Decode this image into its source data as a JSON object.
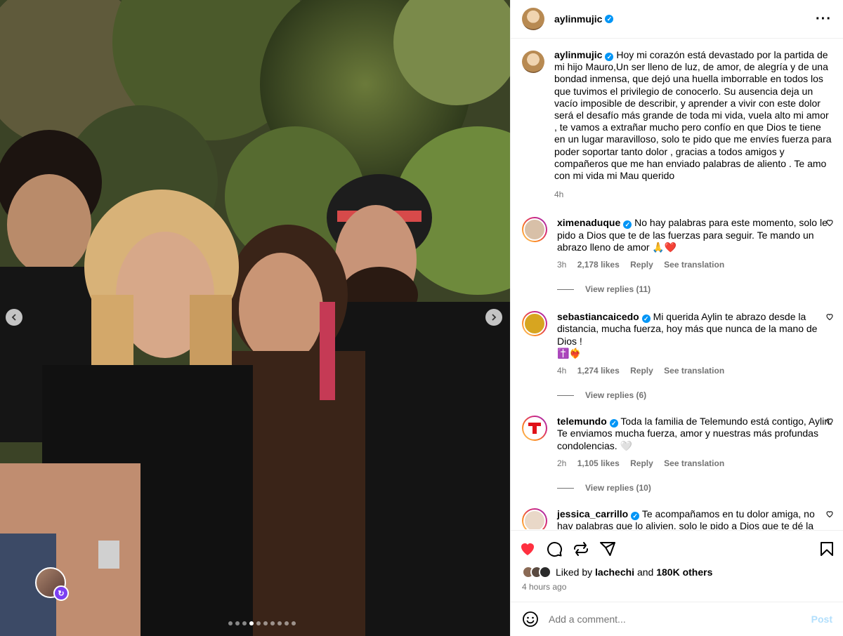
{
  "post": {
    "author": "aylinmujic",
    "more_icon": "more-horizontal-icon",
    "caption": "Hoy mi corazón está devastado por la partida de mi hijo Mauro,Un ser lleno de luz, de amor, de alegría y de una bondad inmensa, que dejó una huella imborrable en todos los que tuvimos el privilegio de conocerlo. Su ausencia deja un vacío imposible de describir, y aprender a vivir con este dolor será el desafío más grande de toda mi vida, vuela alto mi amor , te vamos a extrañar mucho pero confío en que Dios te tiene en un lugar maravilloso, solo te pido que me envíes fuerza para poder soportar tanto dolor , gracias a todos amigos y compañeros que me han enviado palabras de aliento . Te amo con mi vida mi Mau querido",
    "caption_time": "4h"
  },
  "comments": [
    {
      "user": "ximenaduque",
      "text": "No hay palabras para este momento, solo le pido a Dios que te de las fuerzas para seguir. Te mando un abrazo lleno de amor 🙏❤️",
      "time": "3h",
      "likes": "2,178 likes",
      "reply": "Reply",
      "translate": "See translation",
      "replies": "View replies (11)"
    },
    {
      "user": "sebastiancaicedo",
      "text": "Mi querida Aylin te abrazo desde la distancia, mucha fuerza, hoy más que nunca de la mano de Dios !",
      "text2": "✝️❤️‍🔥",
      "time": "4h",
      "likes": "1,274 likes",
      "reply": "Reply",
      "translate": "See translation",
      "replies": "View replies (6)"
    },
    {
      "user": "telemundo",
      "text": "Toda la familia de Telemundo está contigo, Aylin. Te enviamos mucha fuerza, amor y nuestras más profundas condolencias. 🤍",
      "time": "2h",
      "likes": "1,105 likes",
      "reply": "Reply",
      "translate": "See translation",
      "replies": "View replies (10)"
    },
    {
      "user": "jessica_carrillo",
      "text": "Te acompañamos en tu dolor amiga, no hay palabras que lo alivien, solo le pido a Dios que te dé la fuerza que necesitas 💔💔💔❤️‍🩹❤️‍🩹❤️‍🩹 te abrazo con el alma!"
    }
  ],
  "actions": {
    "like_icon": "heart-filled-icon",
    "comment_icon": "comment-icon",
    "repost_icon": "repost-icon",
    "share_icon": "share-icon",
    "save_icon": "bookmark-icon"
  },
  "likes": {
    "prefix": "Liked by",
    "user": "lachechi",
    "and": "and",
    "others": "180K others"
  },
  "timestamp": "4 hours ago",
  "add_comment": {
    "placeholder": "Add a comment...",
    "post_label": "Post"
  },
  "colors": {
    "like_red": "#ff3040",
    "verified_blue": "#0095f6",
    "muted": "#737373"
  }
}
